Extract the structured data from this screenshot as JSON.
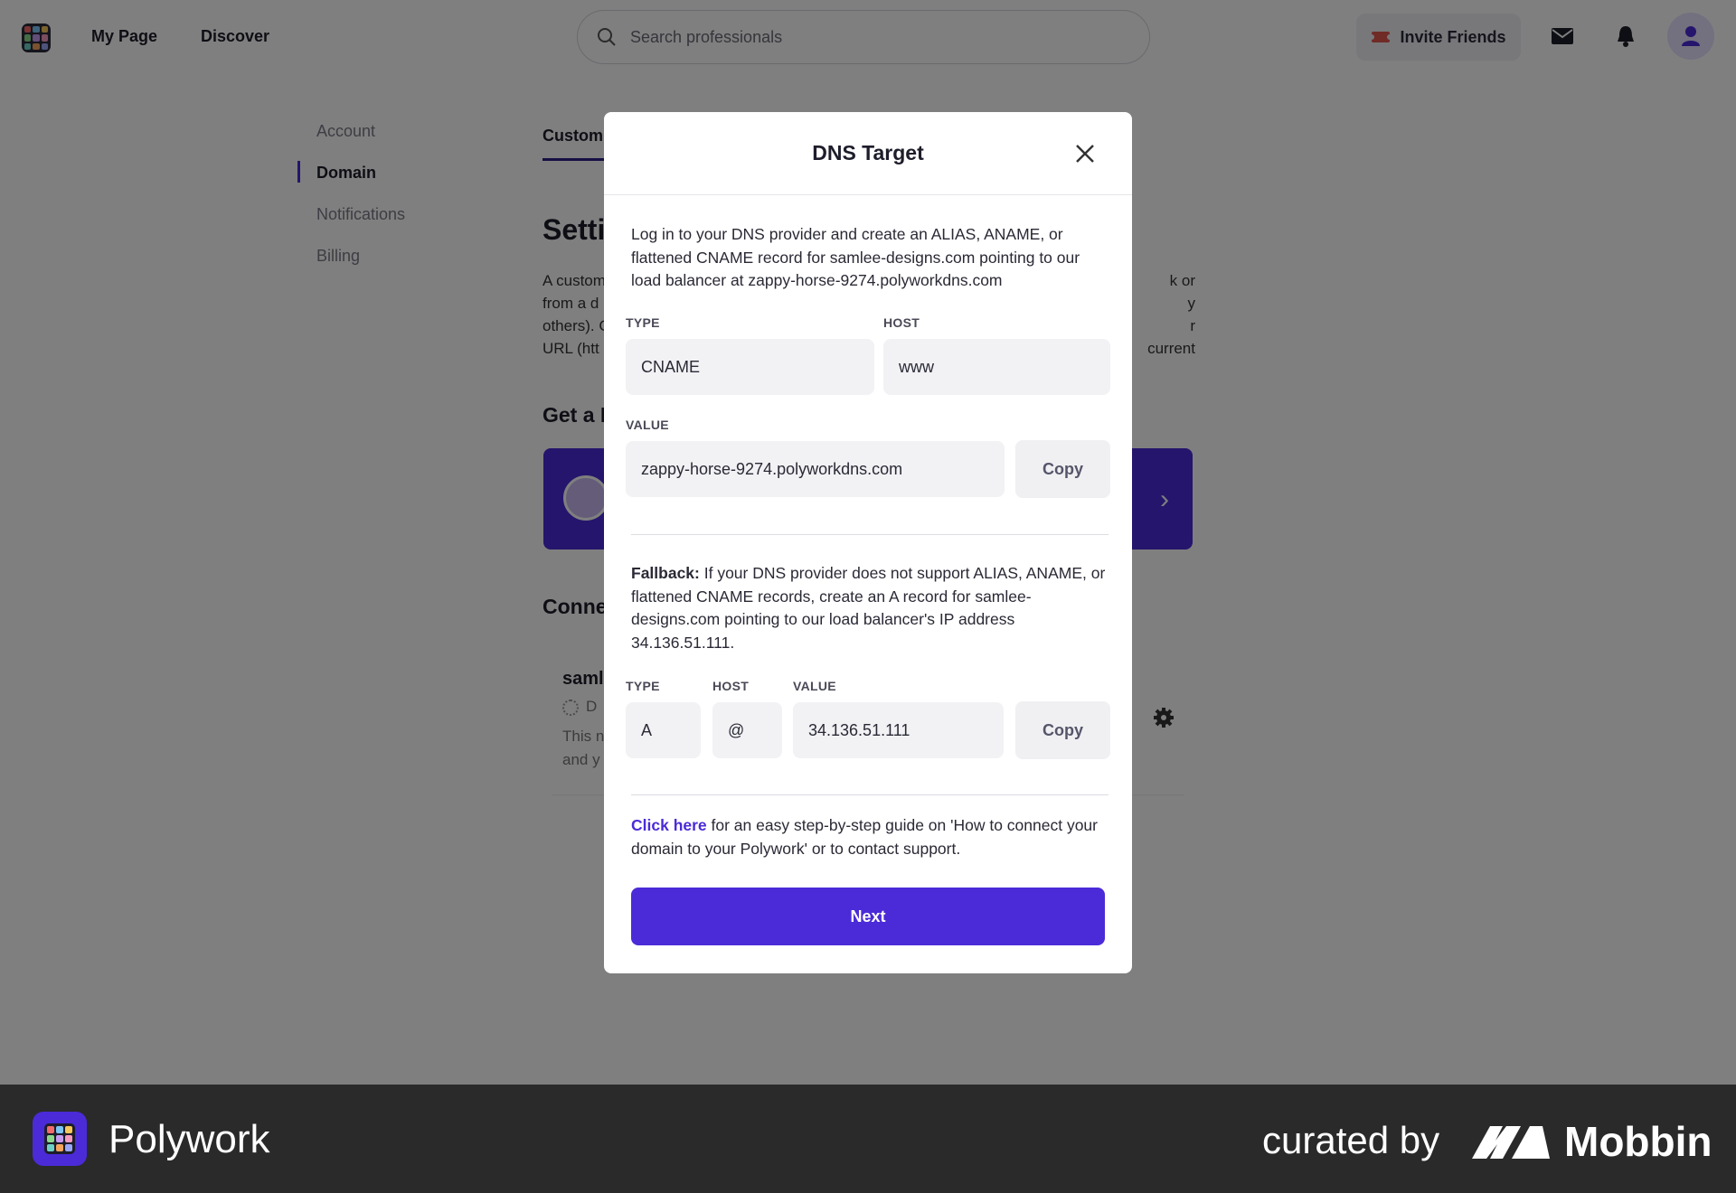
{
  "nav": {
    "my_page": "My Page",
    "discover": "Discover",
    "search_placeholder": "Search professionals",
    "invite": "Invite Friends"
  },
  "sidebar": {
    "items": [
      {
        "label": "Account"
      },
      {
        "label": "Domain"
      },
      {
        "label": "Notifications"
      },
      {
        "label": "Billing"
      }
    ]
  },
  "main": {
    "tab": "Custom",
    "heading": "Setti",
    "paragraph_lines": [
      "A custom",
      "from a d",
      "others). C",
      "URL (htt"
    ],
    "paragraph_right": [
      "k or",
      "y",
      "r current"
    ],
    "get_heading": "Get a N",
    "connect_heading": "Conne",
    "conn_title": "saml",
    "conn_status": "D",
    "conn_desc_lines": [
      "This n",
      "and y"
    ]
  },
  "modal": {
    "title": "DNS Target",
    "intro": "Log in to your DNS provider and create an ALIAS, ANAME, or flattened CNAME record for samlee-designs.com pointing to our load balancer at zappy-horse-9274.polyworkdns.com",
    "type_label": "TYPE",
    "host_label": "HOST",
    "value_label": "VALUE",
    "type_value": "CNAME",
    "host_value": "www",
    "value_value": "zappy-horse-9274.polyworkdns.com",
    "copy": "Copy",
    "fallback_bold": "Fallback:",
    "fallback_text": " If your DNS provider does not support ALIAS, ANAME, or flattened CNAME records, create an A record for samlee-designs.com pointing to our load balancer's IP address 34.136.51.111.",
    "a_type": "A",
    "a_host": "@",
    "a_value": "34.136.51.111",
    "help_link": "Click here",
    "help_text": " for an easy step-by-step guide on 'How to connect your domain to your Polywork' or to contact support.",
    "next": "Next"
  },
  "footer": {
    "brand": "Polywork",
    "curated": "curated by",
    "mobbin": "Mobbin"
  },
  "colors": {
    "accent": "#4b2bd8",
    "overlay": "rgba(0,0,0,0.5)",
    "footer_bg": "#2a2a2a"
  }
}
